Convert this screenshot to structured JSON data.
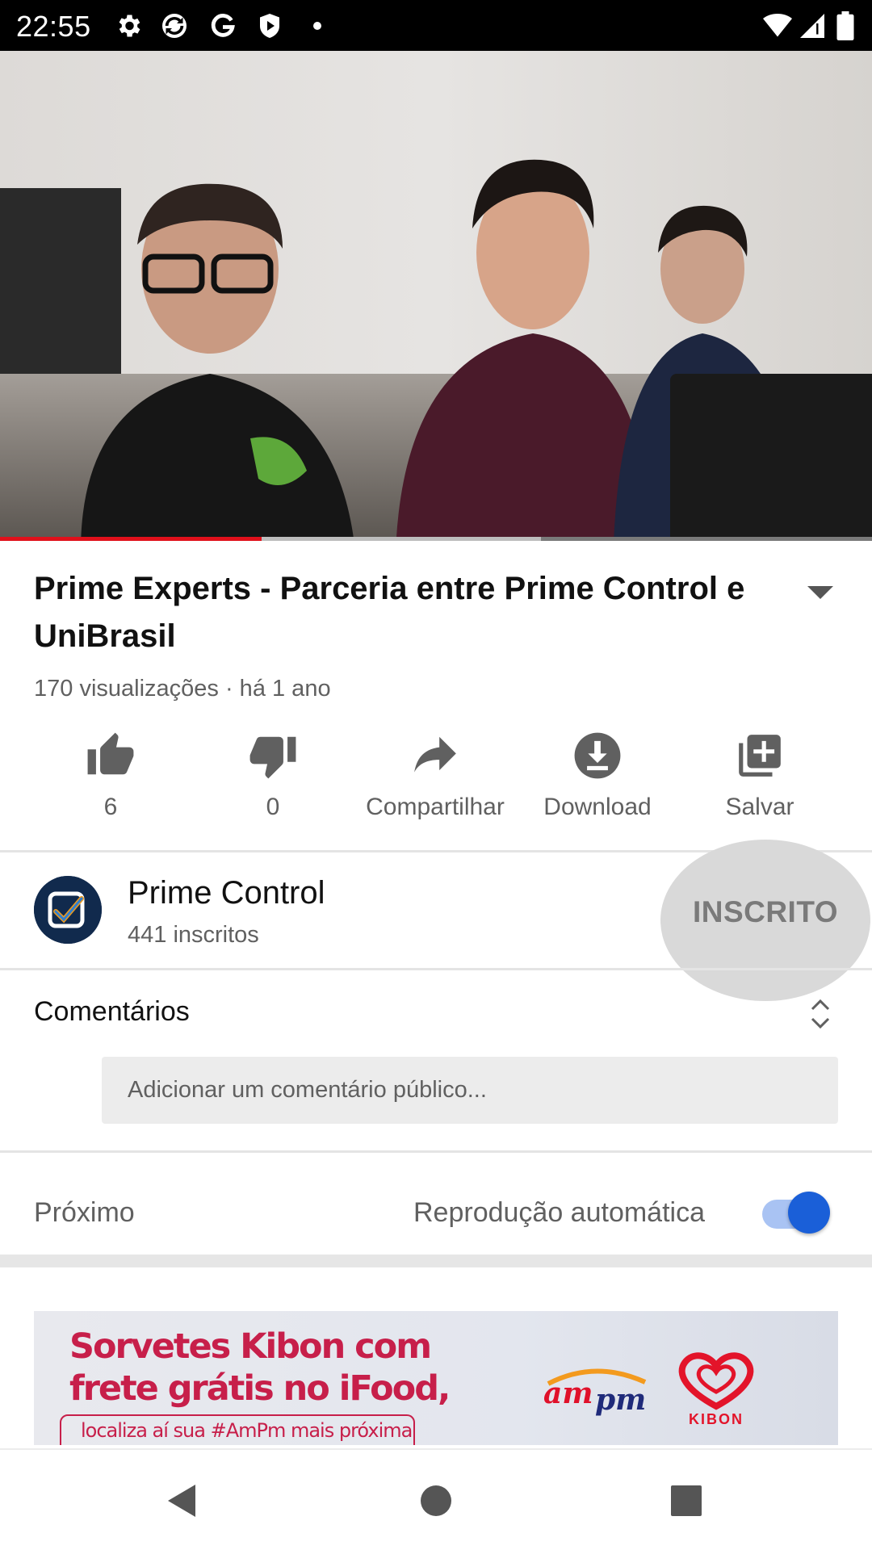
{
  "status_bar": {
    "time": "22:55",
    "left_icons": [
      "gear-icon",
      "sync-icon",
      "google-g-icon",
      "play-shield-icon",
      "dot-icon"
    ],
    "right_icons": [
      "wifi-icon",
      "signal-icon",
      "battery-icon"
    ]
  },
  "video": {
    "progress_fraction": 0.3,
    "buffered_fraction": 0.62
  },
  "video_info": {
    "title": "Prime Experts - Parceria entre Prime Control e UniBrasil",
    "meta": "170 visualizações · há 1 ano"
  },
  "actions": {
    "like_count": "6",
    "dislike_count": "0",
    "share_label": "Compartilhar",
    "download_label": "Download",
    "save_label": "Salvar"
  },
  "channel": {
    "name": "Prime Control",
    "subscribers": "441 inscritos",
    "subscribe_state": "INSCRITO"
  },
  "comments": {
    "title": "Comentários",
    "placeholder": "Adicionar um comentário público..."
  },
  "up_next": {
    "label": "Próximo",
    "autoplay_label": "Reprodução automática",
    "autoplay_on": true
  },
  "ad": {
    "headline": "Sorvetes Kibon com frete grátis no iFood,",
    "tagline": "localiza aí sua #AmPm mais próxima",
    "logo_ampm": "ampm",
    "logo_kibon": "KIBON",
    "colors": {
      "brand": "#c71f4a"
    }
  },
  "colors": {
    "progress": "#e0101b",
    "toggle_knob": "#1a5fd8",
    "toggle_track": "#a9c3f3"
  }
}
